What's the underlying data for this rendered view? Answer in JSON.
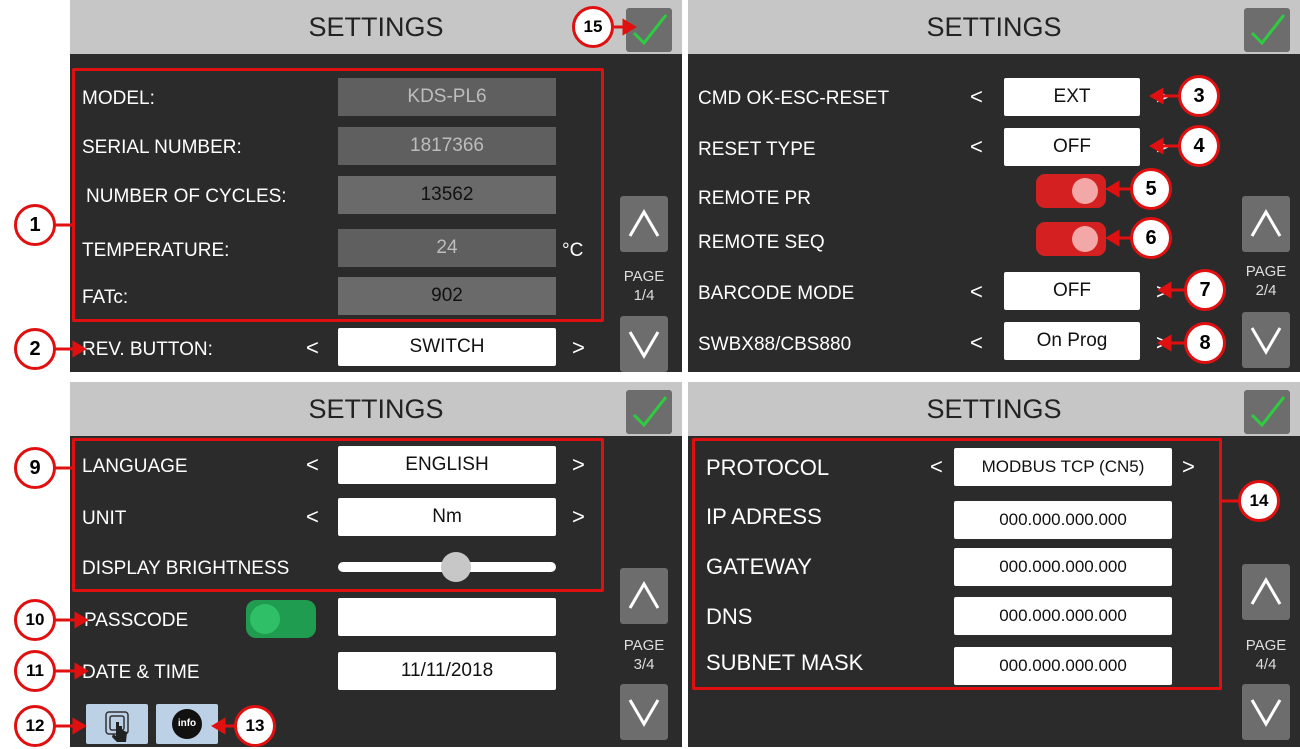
{
  "panels": {
    "p1": {
      "header": "SETTINGS",
      "labels": {
        "model": "MODEL:",
        "serial": "SERIAL NUMBER:",
        "cycles": "NUMBER OF CYCLES:",
        "temperature": "TEMPERATURE:",
        "fatc": "FATc:",
        "rev_button": "REV. BUTTON:"
      },
      "values": {
        "model": "KDS-PL6",
        "serial": "1817366",
        "cycles": "13562",
        "temperature": "24",
        "temperature_unit": "°C",
        "fatc": "902",
        "rev_button": "SWITCH"
      },
      "page": "PAGE",
      "page_num": "1/4"
    },
    "p2": {
      "header": "SETTINGS",
      "labels": {
        "cmd": "CMD OK-ESC-RESET",
        "reset_type": "RESET TYPE",
        "remote_pr": "REMOTE PR",
        "remote_seq": "REMOTE SEQ",
        "barcode": "BARCODE MODE",
        "swbx": "SWBX88/CBS880"
      },
      "values": {
        "cmd": "EXT",
        "reset_type": "OFF",
        "barcode": "OFF",
        "swbx": "On Prog"
      },
      "page": "PAGE",
      "page_num": "2/4"
    },
    "p3": {
      "header": "SETTINGS",
      "labels": {
        "language": "LANGUAGE",
        "unit": "UNIT",
        "brightness": "DISPLAY BRIGHTNESS",
        "passcode": "PASSCODE",
        "datetime": "DATE & TIME"
      },
      "values": {
        "language": "ENGLISH",
        "unit": "Nm",
        "brightness_level": 0.55,
        "passcode": "",
        "datetime": "11/11/2018"
      },
      "info_label": "info",
      "page": "PAGE",
      "page_num": "3/4"
    },
    "p4": {
      "header": "SETTINGS",
      "labels": {
        "protocol": "PROTOCOL",
        "ip": "IP ADRESS",
        "gateway": "GATEWAY",
        "dns": "DNS",
        "subnet": "SUBNET MASK"
      },
      "values": {
        "protocol": "MODBUS TCP (CN5)",
        "ip": "000.000.000.000",
        "gateway": "000.000.000.000",
        "dns": "000.000.000.000",
        "subnet": "000.000.000.000"
      },
      "page": "PAGE",
      "page_num": "4/4"
    }
  },
  "arrows": {
    "left": "<",
    "right": ">"
  },
  "callouts": [
    "1",
    "2",
    "3",
    "4",
    "5",
    "6",
    "7",
    "8",
    "9",
    "10",
    "11",
    "12",
    "13",
    "14",
    "15"
  ],
  "colors": {
    "accent_red": "#e01010",
    "check_green": "#2ecc40",
    "toggle_red": "#d42020",
    "toggle_green": "#1f9c4f"
  }
}
